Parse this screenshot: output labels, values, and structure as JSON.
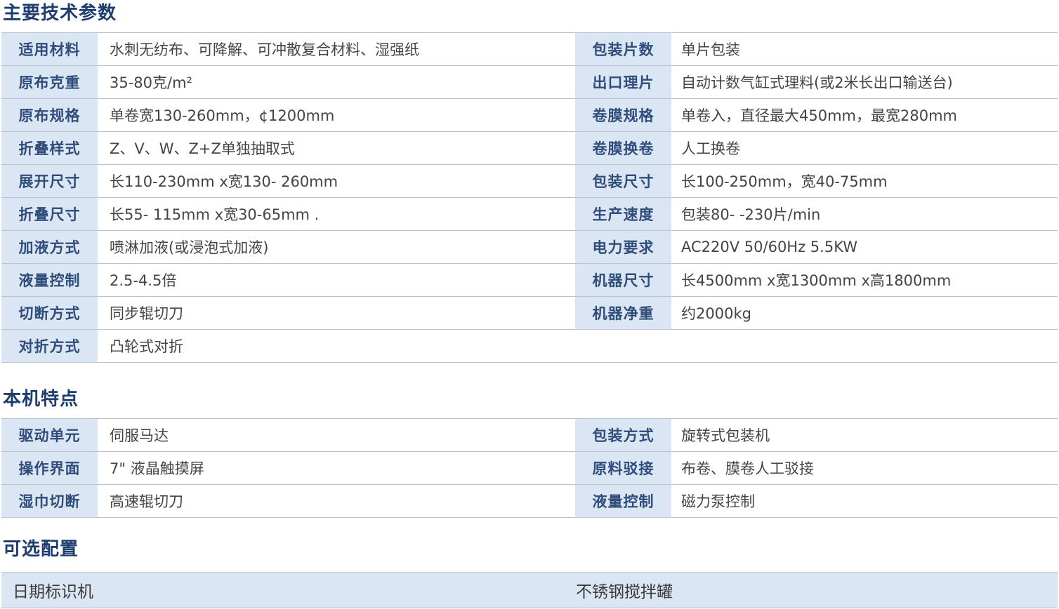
{
  "sections": {
    "specs_title": "主要技术参数",
    "features_title": "本机特点",
    "options_title": "可选配置"
  },
  "specs": [
    {
      "l_label": "适用材料",
      "l_value": "水刺无纺布、可降解、可冲散复合材料、湿强纸",
      "r_label": "包装片数",
      "r_value": "单片包装"
    },
    {
      "l_label": "原布克重",
      "l_value": "35-80克/m²",
      "r_label": "出口理片",
      "r_value": "自动计数气缸式理料(或2米长出口输送台)"
    },
    {
      "l_label": "原布规格",
      "l_value": "单卷宽130-260mm，¢1200mm",
      "r_label": "卷膜规格",
      "r_value": "单卷入，直径最大450mm，最宽280mm"
    },
    {
      "l_label": "折叠样式",
      "l_value": "Z、V、W、Z+Z单独抽取式",
      "r_label": "卷膜换卷",
      "r_value": "人工换卷"
    },
    {
      "l_label": "展开尺寸",
      "l_value": "长110-230mm x宽130- 260mm",
      "r_label": "包装尺寸",
      "r_value": "长100-250mm，宽40-75mm"
    },
    {
      "l_label": "折叠尺寸",
      "l_value": "长55- 115mm x宽30-65mm .",
      "r_label": "生产速度",
      "r_value": "包装80- -230片/min"
    },
    {
      "l_label": "加液方式",
      "l_value": "喷淋加液(或浸泡式加液)",
      "r_label": "电力要求",
      "r_value": "AC220V  50/60Hz  5.5KW"
    },
    {
      "l_label": "液量控制",
      "l_value": "2.5-4.5倍",
      "r_label": "机器尺寸",
      "r_value": "长4500mm x宽1300mm x高1800mm"
    },
    {
      "l_label": "切断方式",
      "l_value": "同步辊切刀",
      "r_label": "机器净重",
      "r_value": "约2000kg"
    },
    {
      "l_label": "对折方式",
      "l_value": "凸轮式对折"
    }
  ],
  "features": [
    {
      "l_label": "驱动单元",
      "l_value": "伺服马达",
      "r_label": "包装方式",
      "r_value": "旋转式包装机"
    },
    {
      "l_label": "操作界面",
      "l_value": "7\" 液晶触摸屏",
      "r_label": "原料驳接",
      "r_value": "布卷、膜卷人工驳接"
    },
    {
      "l_label": "湿巾切断",
      "l_value": "高速辊切刀",
      "r_label": "液量控制",
      "r_value": "磁力泵控制"
    }
  ],
  "options": [
    "日期标识机",
    "不锈钢搅拌罐"
  ]
}
